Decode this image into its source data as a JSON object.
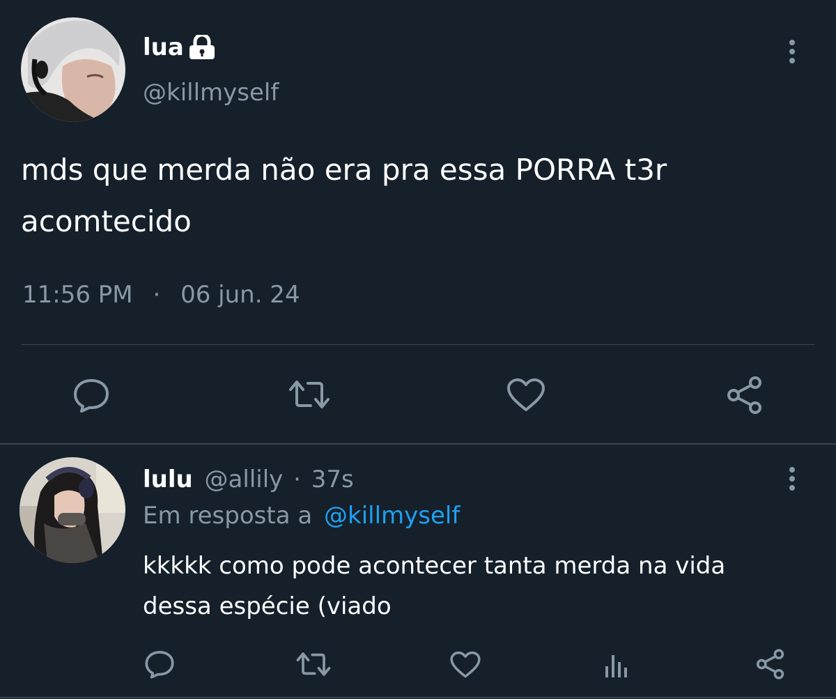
{
  "main_tweet": {
    "display_name": "lua",
    "handle": "@killmyself",
    "text_line1": "mds que merda não era pra essa PORRA t3r",
    "text_line2": "acomtecido",
    "time": "11:56 PM",
    "separator": "·",
    "date": "06 jun. 24",
    "protected": true
  },
  "reply_tweet": {
    "display_name": "lulu",
    "handle": "@allily",
    "separator": "·",
    "age": "37s",
    "replying_to_label": "Em resposta a",
    "replying_to_handle": "@killmyself",
    "text_line1": "kkkkk como pode acontecer tanta merda na vida",
    "text_line2": "dessa espécie (viado"
  },
  "icons": {
    "main_actions": [
      "reply-icon",
      "retweet-icon",
      "like-icon",
      "share-icon"
    ],
    "reply_actions": [
      "reply-icon",
      "retweet-icon",
      "like-icon",
      "analytics-icon",
      "share-icon"
    ],
    "misc": [
      "lock-icon",
      "more-vertical-icon"
    ]
  },
  "colors": {
    "background": "#15202b",
    "text": "#ffffff",
    "muted": "#8899a6",
    "link": "#1da1f2",
    "divider": "#38444d"
  }
}
